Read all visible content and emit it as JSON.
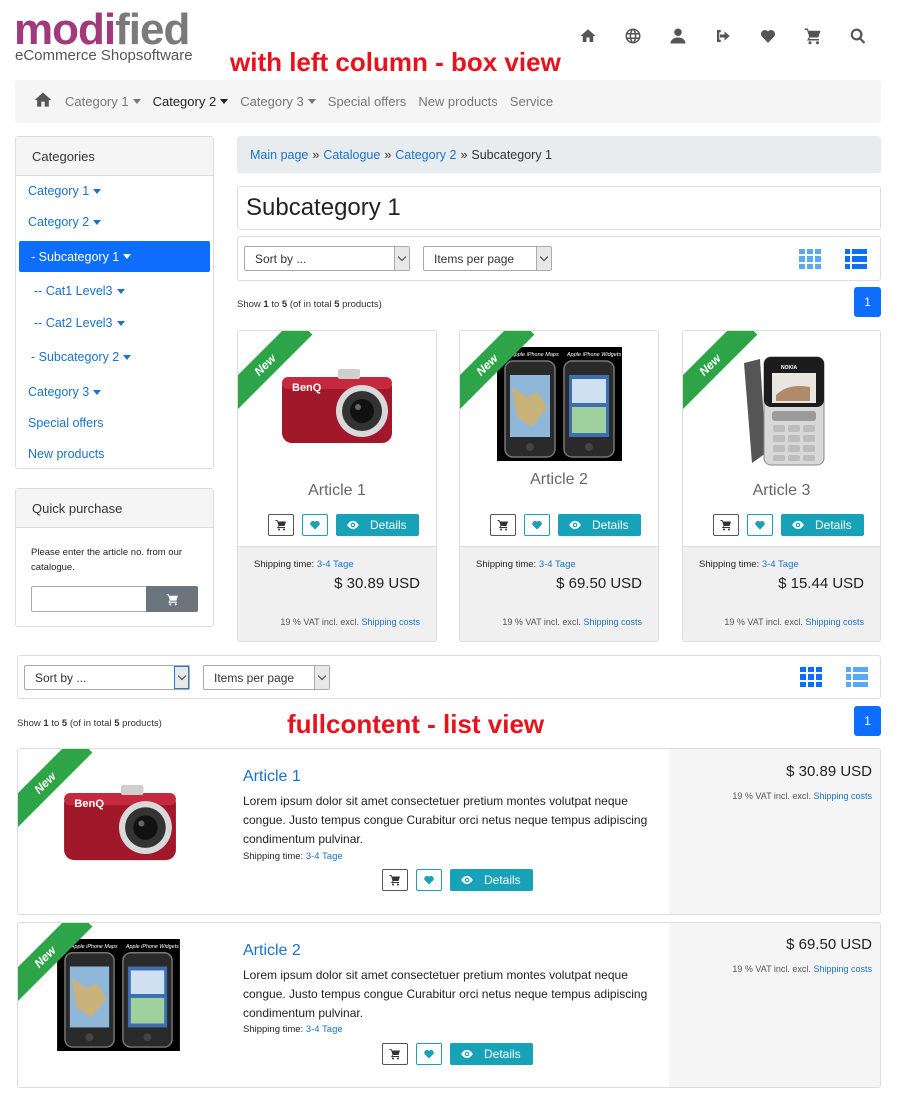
{
  "header": {
    "logo_part1": "modi",
    "logo_part2": "fied",
    "logo_subtitle": "eCommerce Shopsoftware",
    "annotation_top": "with left column - box view",
    "icons": [
      "home-icon",
      "globe-icon",
      "user-icon",
      "logout-icon",
      "heart-icon",
      "cart-icon",
      "search-icon"
    ]
  },
  "nav": {
    "items": [
      {
        "label": "Category 1",
        "dropdown": true
      },
      {
        "label": "Category 2",
        "dropdown": true
      },
      {
        "label": "Category 3",
        "dropdown": true
      },
      {
        "label": "Special offers",
        "dropdown": false
      },
      {
        "label": "New products",
        "dropdown": false
      },
      {
        "label": "Service",
        "dropdown": false
      }
    ]
  },
  "sidebar": {
    "categories_title": "Categories",
    "items": [
      {
        "label": "Category 1"
      },
      {
        "label": "Category 2"
      },
      {
        "label": "- Subcategory 1"
      },
      {
        "label": "-- Cat1 Level3"
      },
      {
        "label": "-- Cat2 Level3"
      },
      {
        "label": "- Subcategory 2"
      },
      {
        "label": "Category 3"
      },
      {
        "label": "Special offers"
      },
      {
        "label": "New products"
      }
    ],
    "quick_title": "Quick purchase",
    "quick_text": "Please enter the article no. from our catalogue.",
    "quick_value": ""
  },
  "breadcrumb": {
    "items": [
      "Main page",
      "Catalogue",
      "Category 2"
    ],
    "separator": "»",
    "current": "Subcategory 1"
  },
  "page_title": "Subcategory 1",
  "toolbar": {
    "sort_label": "Sort by ...",
    "per_page_label": "Items per page"
  },
  "listing": {
    "count_show": "Show",
    "count_from": "1",
    "count_to_word": "to",
    "count_to": "5",
    "count_tail1": "(of in total",
    "count_total": "5",
    "count_tail2": "products)",
    "page": "1"
  },
  "badge": "New",
  "shipping_label": "Shipping time:",
  "shipping_value": "3-4 Tage",
  "vat_text": "19 % VAT incl. excl.",
  "shipping_costs": "Shipping costs",
  "details_label": "Details",
  "products": [
    {
      "name": "Article 1",
      "price": "$ 30.89 USD",
      "image": "camera"
    },
    {
      "name": "Article 2",
      "price": "$ 69.50 USD",
      "image": "iphones"
    },
    {
      "name": "Article 3",
      "price": "$ 15.44 USD",
      "image": "nokia"
    }
  ],
  "iphone_caption_left": "Apple iPhone Maps",
  "iphone_caption_right": "Apple iPhone Widgets",
  "camera_brand": "BenQ",
  "phone_brand": "NOKIA",
  "annotation_bottom": "fullcontent - list view",
  "list_products": [
    {
      "name": "Article 1",
      "price": "$ 30.89 USD",
      "desc": "Lorem ipsum dolor sit amet consectetuer pretium montes volutpat neque congue. Justo tempus congue Curabitur orci netus neque tempus adipiscing condimentum pulvinar."
    },
    {
      "name": "Article 2",
      "price": "$ 69.50 USD",
      "desc": "Lorem ipsum dolor sit amet consectetuer pretium montes volutpat neque congue. Justo tempus congue Curabitur orci netus neque tempus adipiscing condimentum pulvinar."
    }
  ],
  "colors": {
    "accent_blue": "#0d6efd",
    "teal": "#17a2b8",
    "new_badge": "#2ca447",
    "annotation": "#e8121d",
    "logo_purple": "#a03a7a"
  }
}
